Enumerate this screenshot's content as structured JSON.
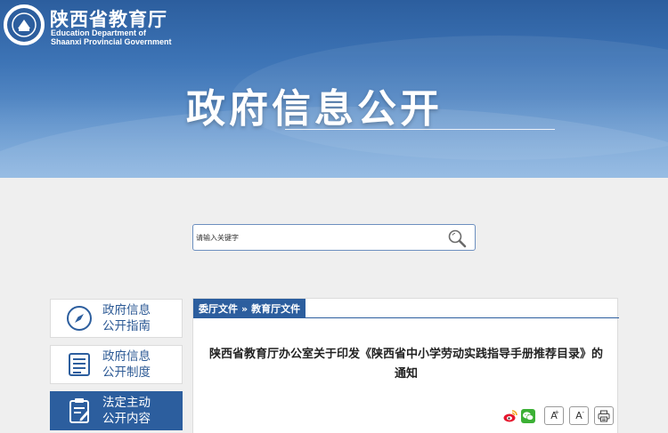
{
  "header": {
    "org_name_cn": "陕西省教育厅",
    "org_name_en_line1": "Education Department of",
    "org_name_en_line2": "Shaanxi Provincial Government",
    "banner_title": "政府信息公开"
  },
  "search": {
    "placeholder": "请输入关键字"
  },
  "sidebar": {
    "items": [
      {
        "label_line1": "政府信息",
        "label_line2": "公开指南",
        "icon": "compass-icon",
        "active": false
      },
      {
        "label_line1": "政府信息",
        "label_line2": "公开制度",
        "icon": "list-document-icon",
        "active": false
      },
      {
        "label_line1": "法定主动",
        "label_line2": "公开内容",
        "icon": "clipboard-edit-icon",
        "active": true
      }
    ]
  },
  "breadcrumb": {
    "items": [
      "委厅文件",
      "教育厅文件"
    ],
    "separator": "»"
  },
  "article": {
    "title_line1": "陕西省教育厅办公室关于印发《陕西省中小学劳动实践指导手册推荐目录》的",
    "title_line2": "通知"
  },
  "tools": {
    "share_weibo": "weibo-icon",
    "share_wechat": "wechat-icon",
    "font_larger_label": "A",
    "font_larger_mark": "+",
    "font_smaller_label": "A",
    "font_smaller_mark": "-",
    "print": "print-icon"
  },
  "colors": {
    "primary": "#2c5e9e",
    "sidebar_text": "#2d5a95",
    "page_background": "#efefef"
  }
}
